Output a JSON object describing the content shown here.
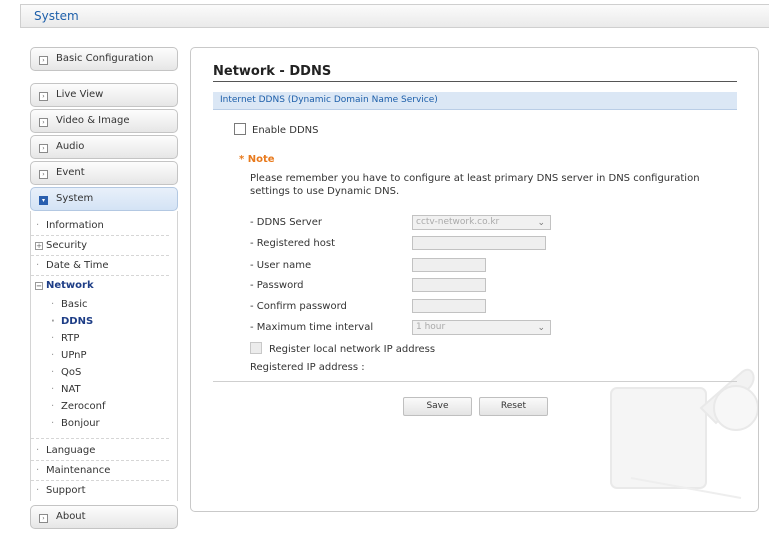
{
  "header": {
    "title": "System"
  },
  "sidebar": {
    "buttons_top": [
      {
        "label": "Basic Configuration"
      },
      {
        "label": "Live View"
      },
      {
        "label": "Video & Image"
      },
      {
        "label": "Audio"
      },
      {
        "label": "Event"
      },
      {
        "label": "System"
      }
    ],
    "system_items": [
      {
        "label": "Information"
      },
      {
        "label": "Security"
      },
      {
        "label": "Date & Time"
      },
      {
        "label": "Network"
      }
    ],
    "network_items": [
      {
        "label": "Basic"
      },
      {
        "label": "DDNS"
      },
      {
        "label": "RTP"
      },
      {
        "label": "UPnP"
      },
      {
        "label": "QoS"
      },
      {
        "label": "NAT"
      },
      {
        "label": "Zeroconf"
      },
      {
        "label": "Bonjour"
      }
    ],
    "other_items": [
      {
        "label": "Language"
      },
      {
        "label": "Maintenance"
      },
      {
        "label": "Support"
      }
    ],
    "about": {
      "label": "About"
    }
  },
  "main": {
    "title": "Network - DDNS",
    "section": "Internet DDNS (Dynamic Domain Name Service)",
    "enable_ddns_label": "Enable DDNS",
    "note_title": "* Note",
    "note_text": "Please remember you have to configure at least primary DNS server in DNS configuration settings to use Dynamic DNS.",
    "fields": {
      "ddns_server": {
        "label": "- DDNS Server",
        "value": "cctv-network.co.kr"
      },
      "registered_host": {
        "label": "- Registered host",
        "value": ""
      },
      "user_name": {
        "label": "- User name",
        "value": ""
      },
      "password": {
        "label": "- Password",
        "value": ""
      },
      "confirm_password": {
        "label": "- Confirm password",
        "value": ""
      },
      "max_interval": {
        "label": "- Maximum time interval",
        "value": "1 hour"
      }
    },
    "register_local_label": "Register local network IP address",
    "registered_ip_label": "Registered IP address :",
    "save_label": "Save",
    "reset_label": "Reset"
  },
  "icons": {
    "collapsed": "plus-box-icon",
    "expanded": "minus-box-icon",
    "chevron": "chevron-down-icon"
  }
}
